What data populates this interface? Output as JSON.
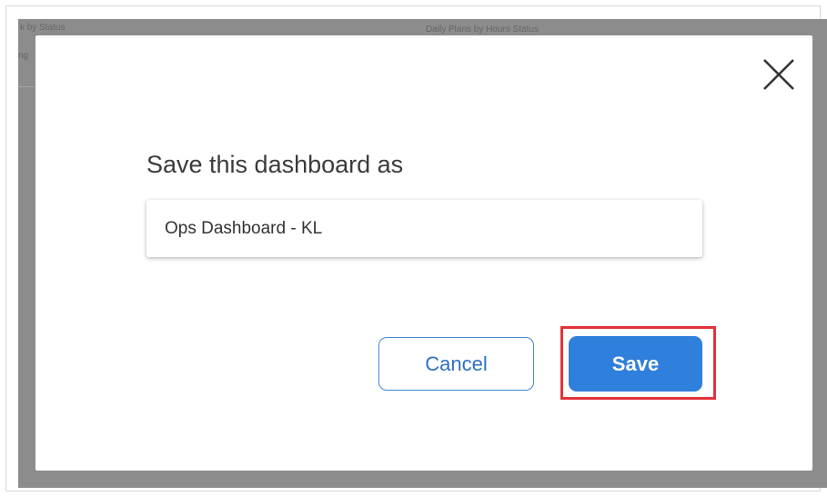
{
  "background": {
    "panel_left_title": "k by Status",
    "panel_right_title": "Daily Plans by Hours Status",
    "panel_left_fragment": "ng"
  },
  "dialog": {
    "title": "Save this dashboard as",
    "close_icon": "close-icon",
    "name_input": {
      "value": "Ops Dashboard - KL",
      "placeholder": ""
    },
    "cancel_label": "Cancel",
    "save_label": "Save"
  },
  "colors": {
    "overlay": "#8c8c8c",
    "accent": "#2f7fdc",
    "cancel_text": "#2f6fc3",
    "highlight": "#e2333a",
    "dialog_background": "#ffffff"
  }
}
